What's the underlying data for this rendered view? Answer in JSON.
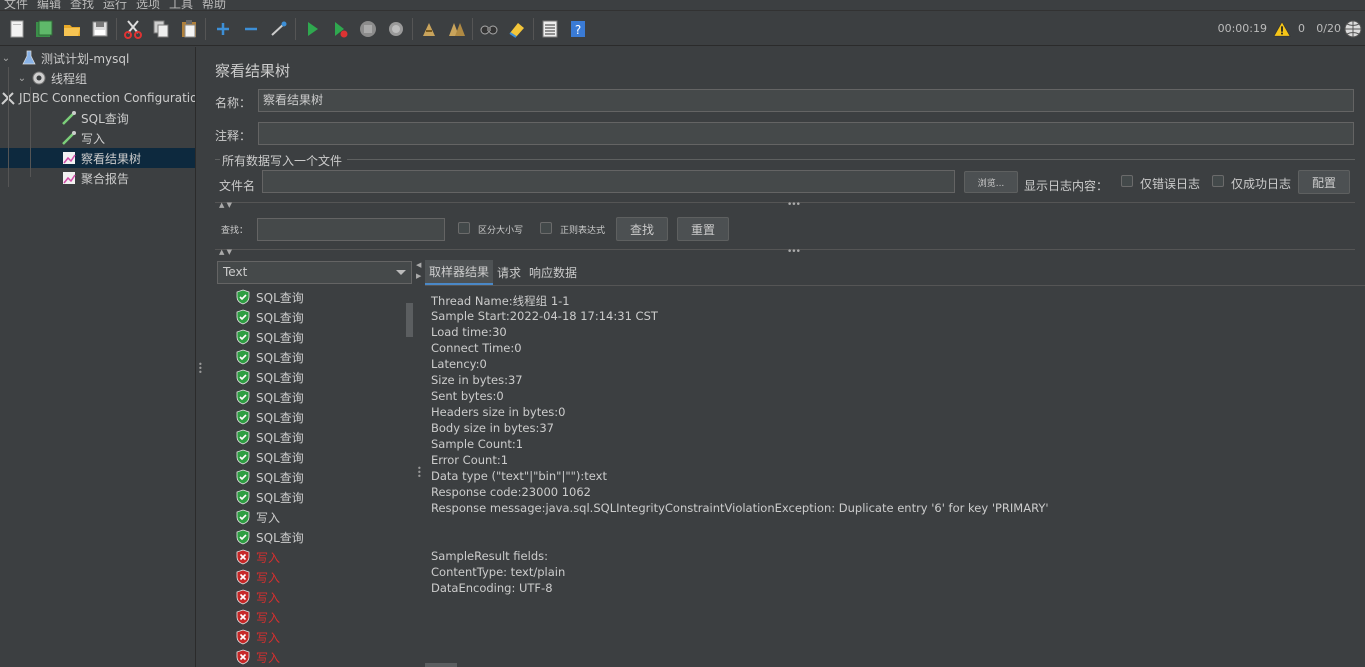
{
  "menubar": {
    "items": [
      "文件",
      "编辑",
      "查找",
      "运行",
      "选项",
      "工具",
      "帮助"
    ]
  },
  "toolbar": {
    "icons": [
      "new-icon",
      "templates-icon",
      "open-icon",
      "save-icon",
      "cut-icon",
      "copy-icon",
      "paste-icon",
      "expand-icon",
      "collapse-icon",
      "toggle-icon",
      "start-icon",
      "start-no-pause-icon",
      "stop-icon",
      "shutdown-icon",
      "clear-icon",
      "clear-all-icon",
      "search-icon",
      "reset-search-icon",
      "function-helper-icon",
      "help-icon"
    ],
    "status": {
      "elapsed": "00:00:19",
      "error_count": "0",
      "threads": "0/20"
    }
  },
  "tree": {
    "items": [
      {
        "label": "测试计划-mysql",
        "icon": "test-plan-icon"
      },
      {
        "label": "线程组",
        "icon": "thread-group-icon"
      },
      {
        "label": "JDBC Connection Configuration",
        "icon": "config-icon"
      },
      {
        "label": "SQL查询",
        "icon": "sampler-icon"
      },
      {
        "label": "写入",
        "icon": "sampler-icon"
      },
      {
        "label": "察看结果树",
        "icon": "listener-icon"
      },
      {
        "label": "聚合报告",
        "icon": "listener-icon"
      }
    ]
  },
  "panel": {
    "title": "察看结果树",
    "name_label": "名称：",
    "name_value": "察看结果树",
    "comment_label": "注释：",
    "comment_value": "",
    "group_title": "所有数据写入一个文件",
    "filename_label": "文件名",
    "filename_value": "",
    "browse_button": "浏览...",
    "log_content_label": "显示日志内容：",
    "errors_only_label": "仅错误日志",
    "success_only_label": "仅成功日志",
    "configure_button": "配置",
    "search_label": "查找：",
    "search_value": "",
    "case_sensitive_label": "区分大小写",
    "regex_label": "正则表达式",
    "find_button": "查找",
    "reset_button": "重置"
  },
  "results": {
    "renderer": "Text",
    "items": [
      {
        "label": "SQL查询",
        "status": "ok"
      },
      {
        "label": "SQL查询",
        "status": "ok"
      },
      {
        "label": "SQL查询",
        "status": "ok"
      },
      {
        "label": "SQL查询",
        "status": "ok"
      },
      {
        "label": "SQL查询",
        "status": "ok"
      },
      {
        "label": "SQL查询",
        "status": "ok"
      },
      {
        "label": "SQL查询",
        "status": "ok"
      },
      {
        "label": "SQL查询",
        "status": "ok"
      },
      {
        "label": "SQL查询",
        "status": "ok"
      },
      {
        "label": "SQL查询",
        "status": "ok"
      },
      {
        "label": "SQL查询",
        "status": "ok"
      },
      {
        "label": "写入",
        "status": "ok"
      },
      {
        "label": "SQL查询",
        "status": "ok"
      },
      {
        "label": "写入",
        "status": "error"
      },
      {
        "label": "写入",
        "status": "error"
      },
      {
        "label": "写入",
        "status": "error"
      },
      {
        "label": "写入",
        "status": "error"
      },
      {
        "label": "写入",
        "status": "error"
      },
      {
        "label": "写入",
        "status": "error"
      }
    ]
  },
  "detail": {
    "tabs": [
      "取样器结果",
      "请求",
      "响应数据"
    ],
    "active_tab": "取样器结果",
    "lines": [
      "Thread Name:线程组 1-1",
      "Sample Start:2022-04-18 17:14:31 CST",
      "Load time:30",
      "Connect Time:0",
      "Latency:0",
      "Size in bytes:37",
      "Sent bytes:0",
      "Headers size in bytes:0",
      "Body size in bytes:37",
      "Sample Count:1",
      "Error Count:1",
      "Data type (\"text\"|\"bin\"|\"\"):text",
      "Response code:23000 1062",
      "Response message:java.sql.SQLIntegrityConstraintViolationException: Duplicate entry '6' for key 'PRIMARY'",
      "",
      "",
      "SampleResult fields:",
      "ContentType: text/plain",
      "DataEncoding: UTF-8"
    ]
  }
}
